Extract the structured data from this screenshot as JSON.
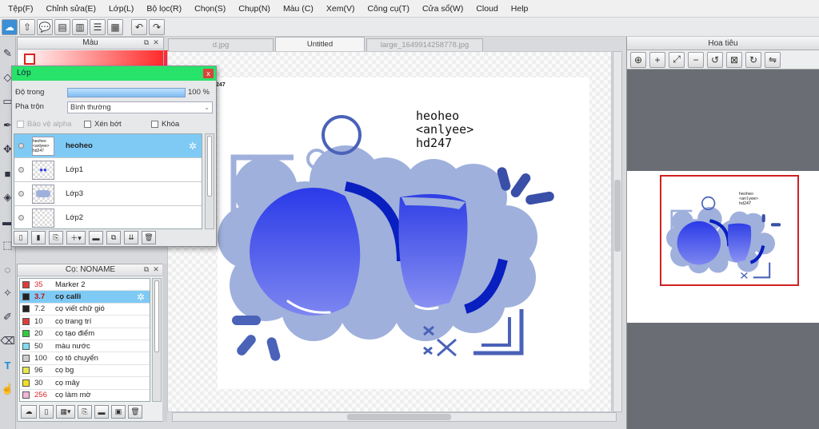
{
  "menu": [
    "Tệp(F)",
    "Chỉnh sửa(E)",
    "Lớp(L)",
    "Bộ lọc(R)",
    "Chọn(S)",
    "Chụp(N)",
    "Màu (C)",
    "Xem(V)",
    "Công cụ(T)",
    "Cửa sổ(W)",
    "Cloud",
    "Help"
  ],
  "color_panel": {
    "title": "Màu"
  },
  "layer_window": {
    "title": "Lớp",
    "close_glyph": "x",
    "opacity_label": "Độ trong",
    "opacity_value": "100 %",
    "opacity_fraction": 1.0,
    "blend_label": "Pha trộn",
    "blend_value": "Bình thường",
    "protect_alpha": "Bảo vệ alpha",
    "clipping": "Xén bớt",
    "lock": "Khóa",
    "layers": [
      {
        "name": "heoheo",
        "thumb_text": "heoheo <anlyee> hd247",
        "selected": true
      },
      {
        "name": "Lớp1",
        "selected": false
      },
      {
        "name": "Lớp3",
        "selected": false
      },
      {
        "name": "Lớp2",
        "selected": false
      }
    ]
  },
  "brush_panel": {
    "title": "Cọ: NONAME",
    "items": [
      {
        "size": "35",
        "name": "Marker 2",
        "color": "#e03a3a",
        "size_red": true
      },
      {
        "size": "3.7",
        "name": "cọ calli",
        "color": "#222222",
        "selected": true
      },
      {
        "size": "7.2",
        "name": "cọ viết chữ gió",
        "color": "#222222"
      },
      {
        "size": "10",
        "name": "cọ trang trí",
        "color": "#e03a3a"
      },
      {
        "size": "20",
        "name": "cọ tạo điểm",
        "color": "#2ecc40"
      },
      {
        "size": "50",
        "name": "màu nước",
        "color": "#7fdcf2"
      },
      {
        "size": "100",
        "name": "cọ tô chuyển",
        "color": "#cccccc"
      },
      {
        "size": "96",
        "name": "cọ bg",
        "color": "#e8e84a"
      },
      {
        "size": "30",
        "name": "cọ mây",
        "color": "#f0e020"
      },
      {
        "size": "256",
        "name": "cọ làm mờ",
        "color": "#f0b8d8",
        "size_red": true
      }
    ]
  },
  "tabs": [
    {
      "label": "d.jpg",
      "active": false
    },
    {
      "label": "Untitled",
      "active": true
    },
    {
      "label": "large_1649914258778.jpg",
      "active": false
    }
  ],
  "canvas": {
    "text_line1": "heoheo",
    "text_line2": "<anlyee>",
    "text_line3": "hd247",
    "corner_label": "247"
  },
  "navigator": {
    "title": "Hoa tiêu"
  },
  "colors": {
    "accent_green": "#28e36a",
    "selection_blue": "#7fcaf5",
    "art_blue": "#2323d8",
    "art_cloud": "#9fb0dc"
  }
}
